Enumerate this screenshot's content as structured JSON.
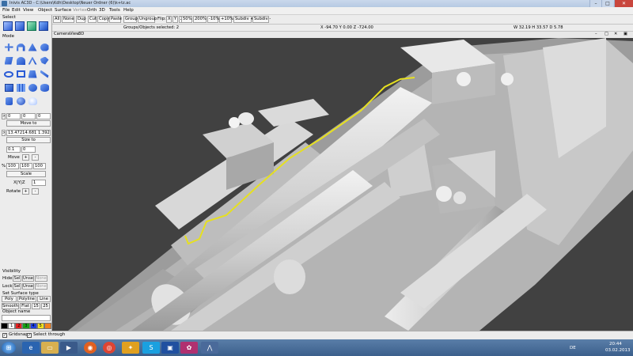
{
  "window": {
    "title": "Inivis AC3D - C:\\Users\\Kdh\\Desktop\\Neuer Ordner (6)\\k+tz.ac",
    "min_label": "–",
    "max_label": "□",
    "close_label": "✕"
  },
  "menu": [
    "File",
    "Edit",
    "View",
    "Object",
    "Surface",
    "Vertex",
    "Orth",
    "3D",
    "Tools",
    "Help"
  ],
  "toolbar": {
    "buttons": [
      "All",
      "None",
      "Dup",
      "Cut",
      "Copy",
      "Paste",
      "Group",
      "Ungroup"
    ],
    "flip_label": "Flip:",
    "flip_axes": [
      "X",
      "Y",
      "Z"
    ],
    "zoom_buttons": [
      "50%",
      "200%",
      "-10%",
      "+10%"
    ],
    "subdiv_plus": "Subdiv +",
    "subdiv_minus": "Subdiv -"
  },
  "status": {
    "groups_selected": "Groups/Objects selected: 2",
    "coords": "X -94.70 Y 0.00 Z -724.00",
    "dimensions": "W 32.19 H 33.57 D 5.78"
  },
  "viewport": {
    "menu": [
      "Camera",
      "View",
      "3D"
    ],
    "window_buttons": [
      "–",
      "□",
      "✕",
      "▣"
    ]
  },
  "left_panel": {
    "select_label": "Select",
    "mode_label": "Mode",
    "move_values": [
      "0",
      "0",
      "0"
    ],
    "move_to_label": "Move to",
    "size_value": "13.47214.681 1.392",
    "size_to_label": "Size to",
    "move_step": [
      "0.1",
      "0"
    ],
    "move_label": "Move",
    "plus": "+",
    "minus": "-",
    "percent_label": "%",
    "scale_values": [
      "100",
      "100",
      "100"
    ],
    "scale_label": "Scale",
    "axis_label": "X|Y|Z",
    "rotate_value": "1",
    "rotate_label": "Rotate",
    "visibility_label": "Visibility",
    "hide_label": "Hide:",
    "lock_label": "Lock:",
    "sel_label": "Sel",
    "unsel_label": "Unsel",
    "none_label": "None",
    "surface_type_label": "Set Surface type",
    "surface_types": [
      "Poly",
      "Polyline",
      "Line"
    ],
    "shading": [
      "Smooth",
      "Flat"
    ],
    "crease_values": [
      "15",
      "25"
    ],
    "object_name_label": "Object name",
    "palette": [
      "#000000",
      "#ffffff",
      "#e62020",
      "#18a018",
      "#2040e0",
      "#f0e020",
      "#f08020"
    ],
    "palette_numbers": [
      "1",
      "2",
      "3",
      "4",
      "5"
    ]
  },
  "bottom": {
    "gridsnap_label": "Gridsnap",
    "select_through_label": "Select through"
  },
  "taskbar": {
    "lang": "DE",
    "time": "20:44",
    "date": "03.02.2013"
  }
}
